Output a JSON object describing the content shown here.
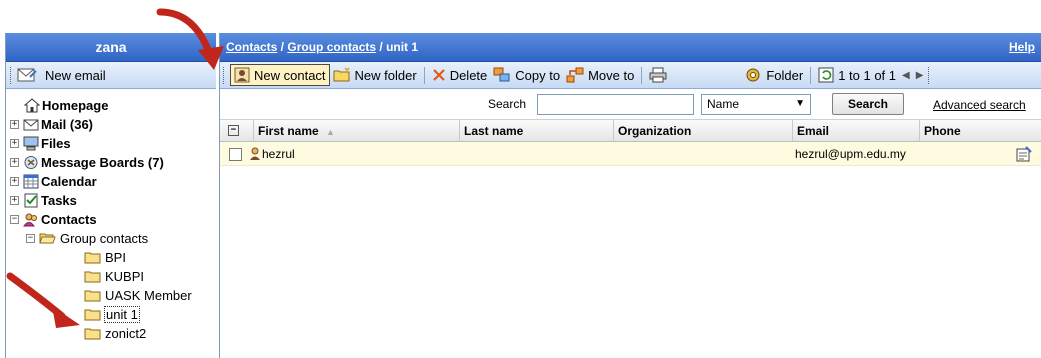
{
  "left": {
    "user_name": "zana",
    "new_email_label": "New email",
    "tree": {
      "homepage": "Homepage",
      "mail": "Mail (36)",
      "files": "Files",
      "message_boards": "Message Boards (7)",
      "calendar": "Calendar",
      "tasks": "Tasks",
      "contacts": "Contacts",
      "group_contacts": "Group contacts",
      "groups": [
        "BPI",
        "KUBPI",
        "UASK Member",
        "unit 1",
        "zonict2"
      ]
    }
  },
  "breadcrumb": {
    "contacts": "Contacts",
    "sep1": " / ",
    "group_contacts": "Group contacts",
    "sep2": " / ",
    "current": "unit 1",
    "help": "Help"
  },
  "toolbar": {
    "new_contact": "New contact",
    "new_folder": "New folder",
    "delete": "Delete",
    "copy_to": "Copy to",
    "move_to": "Move to",
    "folder": "Folder",
    "pagination": "1 to 1 of 1"
  },
  "search": {
    "label": "Search",
    "input_value": "",
    "field_selected": "Name",
    "button": "Search",
    "advanced": "Advanced search"
  },
  "table": {
    "columns": [
      "First name",
      "Last name",
      "Organization",
      "Email",
      "Phone"
    ],
    "rows": [
      {
        "first_name": "hezrul",
        "last_name": "",
        "organization": "",
        "email": "hezrul@upm.edu.my",
        "phone": ""
      }
    ]
  },
  "colors": {
    "header_blue": "#2f64c4",
    "toolbar_light": "#c8daf3",
    "row_highlight": "#fffbe0",
    "arrow_red": "#c0261c"
  }
}
